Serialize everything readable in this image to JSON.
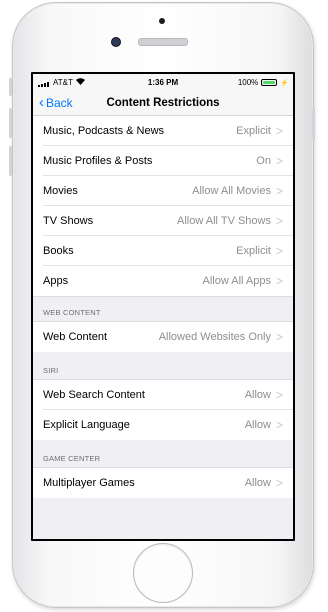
{
  "status_bar": {
    "carrier": "AT&T",
    "time": "1:36 PM",
    "battery": "100%",
    "battery_level": 1.0
  },
  "nav": {
    "back_label": "Back",
    "title": "Content Restrictions"
  },
  "top_rows": [
    {
      "label": "Music, Podcasts & News",
      "value": "Explicit"
    },
    {
      "label": "Music Profiles & Posts",
      "value": "On"
    },
    {
      "label": "Movies",
      "value": "Allow All Movies"
    },
    {
      "label": "TV Shows",
      "value": "Allow All TV Shows"
    },
    {
      "label": "Books",
      "value": "Explicit"
    },
    {
      "label": "Apps",
      "value": "Allow All Apps"
    }
  ],
  "web_content": {
    "header": "WEB CONTENT",
    "rows": [
      {
        "label": "Web Content",
        "value": "Allowed Websites Only"
      }
    ]
  },
  "siri": {
    "header": "SIRI",
    "rows": [
      {
        "label": "Web Search Content",
        "value": "Allow"
      },
      {
        "label": "Explicit Language",
        "value": "Allow"
      }
    ]
  },
  "game_center": {
    "header": "GAME CENTER",
    "rows": [
      {
        "label": "Multiplayer Games",
        "value": "Allow"
      }
    ]
  },
  "colors": {
    "accent": "#007aff",
    "battery": "#4cd964",
    "background": "#efeff4"
  }
}
